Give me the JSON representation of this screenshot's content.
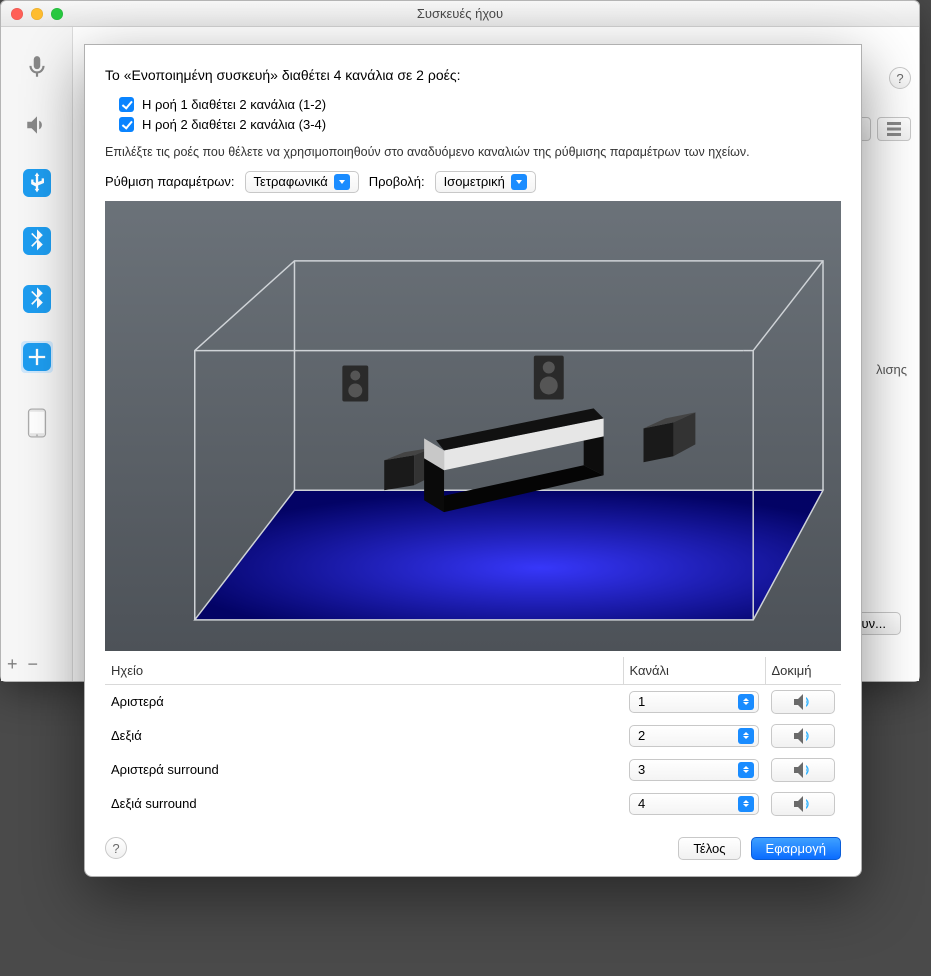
{
  "window": {
    "title": "Συσκευές ήχου"
  },
  "sidebar": {
    "footer": {
      "plus": "+",
      "minus": "−"
    }
  },
  "background": {
    "right_text_fragment_1": "λισης",
    "right_text_fragment_2": "ν...",
    "right_text_fragment_3": "υν..."
  },
  "sheet": {
    "header": "Το «Ενοποιημένη συσκευή» διαθέτει 4 κανάλια σε 2 ροές:",
    "streams": [
      {
        "label": "Η ροή 1 διαθέτει 2 κανάλια (1-2)",
        "checked": true
      },
      {
        "label": "Η ροή 2 διαθέτει 2 κανάλια (3-4)",
        "checked": true
      }
    ],
    "note": "Επιλέξτε τις ροές που θέλετε να χρησιμοποιηθούν στο αναδυόμενο καναλιών της ρύθμισης παραμέτρων των ηχείων.",
    "config_label": "Ρύθμιση παραμέτρων:",
    "config_value": "Τετραφωνικά",
    "view_label": "Προβολή:",
    "view_value": "Ισομετρική",
    "columns": {
      "speaker": "Ηχείο",
      "channel": "Κανάλι",
      "test": "Δοκιμή"
    },
    "rows": [
      {
        "speaker": "Αριστερά",
        "channel": "1"
      },
      {
        "speaker": "Δεξιά",
        "channel": "2"
      },
      {
        "speaker": "Αριστερά surround",
        "channel": "3"
      },
      {
        "speaker": "Δεξιά surround",
        "channel": "4"
      }
    ],
    "buttons": {
      "done": "Τέλος",
      "apply": "Εφαρμογή"
    }
  }
}
